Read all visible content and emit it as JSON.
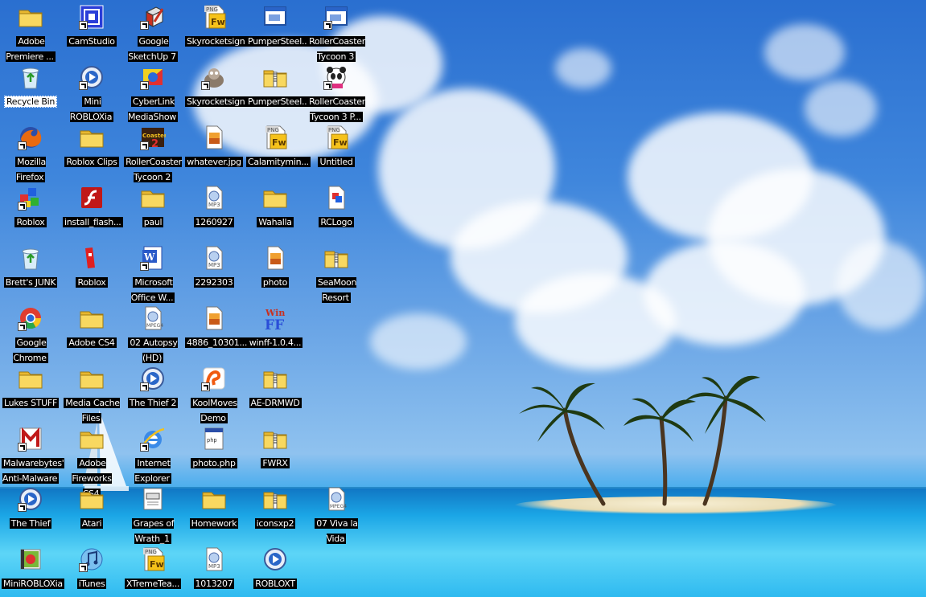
{
  "desktop": {
    "icons": [
      {
        "label": "Adobe Premiere ...",
        "icon": "folder-icon",
        "type": "folder",
        "shortcut": false
      },
      {
        "label": "CamStudio",
        "icon": "camstudio-icon",
        "type": "app",
        "shortcut": true
      },
      {
        "label": "Google SketchUp 7",
        "icon": "sketchup-icon",
        "type": "app",
        "shortcut": true
      },
      {
        "label": "Skyrocketsign",
        "icon": "fireworks-png-icon",
        "type": "fw",
        "shortcut": false
      },
      {
        "label": "PumperSteel...",
        "icon": "window-app-icon",
        "type": "app",
        "shortcut": false
      },
      {
        "label": "RollerCoaster Tycoon 3",
        "icon": "window-app-icon",
        "type": "app",
        "shortcut": true
      },
      {
        "label": "Recycle Bin",
        "icon": "recycle-bin-icon",
        "type": "recycle",
        "shortcut": false,
        "selected": true
      },
      {
        "label": "Mini ROBLOXia",
        "icon": "media-player-icon",
        "type": "media",
        "shortcut": true
      },
      {
        "label": "CyberLink MediaShow",
        "icon": "mediashow-icon",
        "type": "app",
        "shortcut": true
      },
      {
        "label": "Skyrocketsign",
        "icon": "gimp-icon",
        "type": "app",
        "shortcut": true
      },
      {
        "label": "PumperSteel...",
        "icon": "zip-folder-icon",
        "type": "zip",
        "shortcut": false
      },
      {
        "label": "RollerCoaster Tycoon 3 P...",
        "icon": "panda-icon",
        "type": "app",
        "shortcut": true
      },
      {
        "label": "Mozilla Firefox",
        "icon": "firefox-icon",
        "type": "firefox",
        "shortcut": true
      },
      {
        "label": "Roblox Clips",
        "icon": "folder-icon",
        "type": "folder",
        "shortcut": false
      },
      {
        "label": "RollerCoaster Tycoon 2",
        "icon": "rct2-icon",
        "type": "app",
        "shortcut": true
      },
      {
        "label": "whatever.jpg",
        "icon": "image-file-icon",
        "type": "image",
        "shortcut": false
      },
      {
        "label": "Calamitymin...",
        "icon": "fireworks-png-icon",
        "type": "fw",
        "shortcut": false
      },
      {
        "label": "Untitled",
        "icon": "fireworks-png-icon",
        "type": "fw",
        "shortcut": false
      },
      {
        "label": "Roblox",
        "icon": "roblox-cubes-icon",
        "type": "cubes",
        "shortcut": true
      },
      {
        "label": "install_flash...",
        "icon": "flash-icon",
        "type": "flash",
        "shortcut": false
      },
      {
        "label": "paul",
        "icon": "folder-icon",
        "type": "folder",
        "shortcut": false
      },
      {
        "label": "1260927",
        "icon": "mp3-file-icon",
        "type": "mp3",
        "shortcut": false
      },
      {
        "label": "Wahalla",
        "icon": "folder-icon",
        "type": "folder",
        "shortcut": false
      },
      {
        "label": "RCLogo",
        "icon": "paint-file-icon",
        "type": "paint",
        "shortcut": false
      },
      {
        "label": "Brett's JUNK",
        "icon": "recycle-bin-icon",
        "type": "recycle",
        "shortcut": false
      },
      {
        "label": "Roblox",
        "icon": "roblox-logo-icon",
        "type": "roblox",
        "shortcut": false
      },
      {
        "label": "Microsoft Office W...",
        "icon": "word-icon",
        "type": "word",
        "shortcut": true
      },
      {
        "label": "2292303",
        "icon": "mp3-file-icon",
        "type": "mp3",
        "shortcut": false
      },
      {
        "label": "photo",
        "icon": "image-file-icon",
        "type": "image",
        "shortcut": false
      },
      {
        "label": "SeaMoon Resort",
        "icon": "zip-folder-icon",
        "type": "zip",
        "shortcut": false
      },
      {
        "label": "Google Chrome",
        "icon": "chrome-icon",
        "type": "chrome",
        "shortcut": true
      },
      {
        "label": "Adobe CS4",
        "icon": "folder-icon",
        "type": "folder",
        "shortcut": false
      },
      {
        "label": "02 Autopsy (HD)",
        "icon": "mpeg4-file-icon",
        "type": "mpeg",
        "shortcut": false
      },
      {
        "label": "4886_10301...",
        "icon": "image-file-icon",
        "type": "image",
        "shortcut": false
      },
      {
        "label": "winff-1.0.4...",
        "icon": "winff-icon",
        "type": "winff",
        "shortcut": false
      },
      {
        "label": "",
        "icon": "",
        "type": "none",
        "shortcut": false
      },
      {
        "label": "Lukes STUFF",
        "icon": "folder-icon",
        "type": "folder",
        "shortcut": false
      },
      {
        "label": "Media Cache Files",
        "icon": "folder-icon",
        "type": "folder",
        "shortcut": false
      },
      {
        "label": "The Thief 2",
        "icon": "media-player-icon",
        "type": "media",
        "shortcut": true
      },
      {
        "label": "KoolMoves Demo",
        "icon": "koolmoves-icon",
        "type": "kool",
        "shortcut": true
      },
      {
        "label": "AE-DRMWD",
        "icon": "zip-folder-icon",
        "type": "zip",
        "shortcut": false
      },
      {
        "label": "",
        "icon": "",
        "type": "none",
        "shortcut": false
      },
      {
        "label": "Malwarebytes' Anti-Malware",
        "icon": "malwarebytes-icon",
        "type": "malware",
        "shortcut": true
      },
      {
        "label": "Adobe Fireworks CS4",
        "icon": "folder-icon",
        "type": "folder",
        "shortcut": false
      },
      {
        "label": "Internet Explorer",
        "icon": "internet-explorer-icon",
        "type": "ie",
        "shortcut": true
      },
      {
        "label": "photo.php",
        "icon": "php-file-icon",
        "type": "doc",
        "shortcut": false
      },
      {
        "label": "FWRX",
        "icon": "zip-folder-icon",
        "type": "zip",
        "shortcut": false
      },
      {
        "label": "",
        "icon": "",
        "type": "none",
        "shortcut": false
      },
      {
        "label": "The Thief",
        "icon": "media-player-icon",
        "type": "media",
        "shortcut": true
      },
      {
        "label": "Atari",
        "icon": "folder-icon",
        "type": "folder",
        "shortcut": false
      },
      {
        "label": "Grapes of Wrath_1",
        "icon": "document-icon",
        "type": "doc",
        "shortcut": false
      },
      {
        "label": "Homework",
        "icon": "folder-icon",
        "type": "folder",
        "shortcut": false
      },
      {
        "label": "iconsxp2",
        "icon": "zip-folder-icon",
        "type": "zip",
        "shortcut": false
      },
      {
        "label": "07 Viva la Vida",
        "icon": "mpeg4-file-icon",
        "type": "mpeg",
        "shortcut": false
      },
      {
        "label": "MiniROBLOXia",
        "icon": "video-file-icon",
        "type": "video",
        "shortcut": false
      },
      {
        "label": "iTunes",
        "icon": "itunes-icon",
        "type": "itunes",
        "shortcut": true
      },
      {
        "label": "XTremeTea...",
        "icon": "fireworks-png-icon",
        "type": "fw",
        "shortcut": false
      },
      {
        "label": "1013207",
        "icon": "mp3-file-icon",
        "type": "mp3",
        "shortcut": false
      },
      {
        "label": "ROBLOXT",
        "icon": "media-player-icon",
        "type": "media",
        "shortcut": false
      },
      {
        "label": "",
        "icon": "",
        "type": "none",
        "shortcut": false
      }
    ]
  },
  "colors": {
    "label_bg": "#000000",
    "label_text": "#ffffff",
    "folder": "#f5d040",
    "sky": "#3f86dc",
    "sea": "#1ea3e6"
  }
}
